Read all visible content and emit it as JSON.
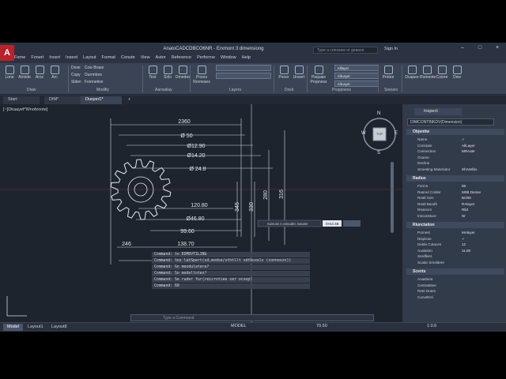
{
  "app": {
    "title": "AnatoCADCDBCO6NR - Erxmont 3 dimensiong",
    "logo": "A",
    "search_placeholder": "Type a conssew or geason",
    "signin": "Sign In",
    "window_controls": "– □ ×"
  },
  "menubar": [
    "Forne",
    "Fonert",
    "Insert",
    "Inseot",
    "Layout",
    "Format",
    "Conute",
    "View",
    "Autor",
    "Reference",
    "Perforrne",
    "Window",
    "Help"
  ],
  "ribbon": {
    "draw": {
      "buttons": [
        "Lone",
        "Airoide",
        "Aroc",
        "Arc"
      ],
      "label": "Dtaw"
    },
    "modify": {
      "items": [
        "Dove",
        "Copy",
        "Siden",
        "Cow Brase",
        "Ournntors",
        "Fornnetive"
      ],
      "label": "Modifiy"
    },
    "annotation": {
      "buttons": [
        "Text",
        "Solo",
        "Dmedes"
      ],
      "label": "Aansaliay"
    },
    "layers": {
      "buttons": [
        "Pozes Rorneses"
      ],
      "label": "Layers"
    },
    "block": {
      "buttons": [
        "Poner",
        "Unsert"
      ],
      "label": "Dock"
    },
    "properties": {
      "buttons": [
        "Paquaie Propness"
      ],
      "label": "Proppness",
      "combos": [
        "Alllayer",
        "AllLayer",
        "AllLayer"
      ]
    },
    "group": {
      "buttons": [
        "Protee"
      ],
      "label": "Sneuos"
    },
    "utilities": {
      "buttons": [
        "Dvapee",
        "Romonte",
        "Coiore",
        "Dew"
      ],
      "label": ""
    }
  },
  "tabs": [
    "Start",
    "DIM*",
    "Dusyer1*"
  ],
  "viewport_label": "[~]Dkaayef*Wnofzonte]",
  "drawing": {
    "dims": [
      "2360",
      "Ø 50",
      "Ø12.90",
      "Ø14.20",
      "Ø 24.8",
      "120.80",
      "Ø46.80",
      "99.60",
      "246",
      "138.70",
      "109.80",
      "345",
      "330",
      "280",
      "316"
    ],
    "tooltip": "Suinuos s ovtoudirc nasarie",
    "tooltip_value": "0H1C4B",
    "compass": {
      "top": "N",
      "top_label": "TOP",
      "left": "W",
      "right": "E",
      "bottom": "S"
    }
  },
  "command": {
    "history": [
      "Command: to DIMDVTILING",
      "Command: tox latSpert(sd,modse/sthtllt sdtboxels (conneszs))",
      "Command: Go moodulatere?",
      "Command: So modellotex?",
      "Command: Se ruder fur(reicrotiee ser ocoop)",
      "Command: 60"
    ],
    "input_placeholder": "Type a Command"
  },
  "properties": {
    "tab": "Inspect",
    "object": "DIMCONTBIKDV(Dimension)",
    "sections": [
      {
        "title": "Objentiw",
        "rows": [
          [
            "Name",
            "✓"
          ],
          [
            "Constate",
            "AllLayer"
          ],
          [
            "Connection",
            "MRAate"
          ],
          [
            "Ocame",
            ""
          ],
          [
            "Decline",
            ""
          ],
          [
            "Smeeting Materiator",
            "ShAssfex"
          ]
        ]
      },
      {
        "title": "Radius",
        "rows": [
          [
            "Forms",
            "55"
          ],
          [
            "Rasred Colder",
            "M0B Dense"
          ],
          [
            "Reall Size",
            "BO06"
          ],
          [
            "Reall Bandh",
            "RAlayer"
          ],
          [
            "Reascen",
            "Rlid"
          ],
          [
            "Inscoesture",
            "W"
          ]
        ]
      },
      {
        "title": "Riunctation",
        "rows": [
          [
            "Pornest",
            "MAlayer"
          ],
          [
            "Displese",
            "✓"
          ],
          [
            "Delde Cotaces",
            "12"
          ],
          [
            "Auslation",
            "11.80"
          ],
          [
            "Serdfiers",
            ""
          ],
          [
            "Scalar Smeldere",
            ""
          ]
        ]
      },
      {
        "title": "Scents",
        "rows": [
          [
            "Anasbeot",
            ""
          ],
          [
            "Centrabitee",
            ""
          ],
          [
            "Rete Dutes",
            ""
          ],
          [
            "Curveltrel",
            ""
          ]
        ]
      }
    ]
  },
  "status": {
    "layout_tabs": [
      "Model",
      "Layout1",
      "Layout8"
    ],
    "model": "MODEL",
    "coords": "70.50",
    "scale": "1:0.6"
  }
}
